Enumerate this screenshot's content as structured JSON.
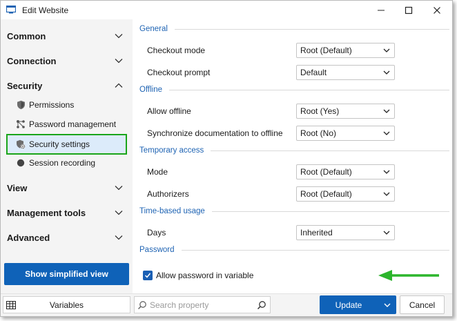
{
  "window": {
    "title": "Edit Website"
  },
  "sidebar": {
    "categories": [
      {
        "label": "Common"
      },
      {
        "label": "Connection"
      },
      {
        "label": "Security"
      },
      {
        "label": "View"
      },
      {
        "label": "Management tools"
      },
      {
        "label": "Advanced"
      }
    ],
    "security_items": [
      {
        "label": "Permissions",
        "icon": "shield-icon"
      },
      {
        "label": "Password management",
        "icon": "share-nodes-icon"
      },
      {
        "label": "Security settings",
        "icon": "shield-gear-icon",
        "selected": true
      },
      {
        "label": "Session recording",
        "icon": "record-dot-icon"
      }
    ],
    "simplified_view_label": "Show simplified view"
  },
  "content": {
    "sections": {
      "general": "General",
      "offline": "Offline",
      "temporary_access": "Temporary access",
      "time_based_usage": "Time-based usage",
      "password": "Password"
    },
    "fields": {
      "checkout_mode": {
        "label": "Checkout mode",
        "value": "Root (Default)"
      },
      "checkout_prompt": {
        "label": "Checkout prompt",
        "value": "Default"
      },
      "allow_offline": {
        "label": "Allow offline",
        "value": "Root (Yes)"
      },
      "sync_docs": {
        "label": "Synchronize documentation to offline",
        "value": "Root (No)"
      },
      "mode": {
        "label": "Mode",
        "value": "Root (Default)"
      },
      "authorizers": {
        "label": "Authorizers",
        "value": "Root (Default)"
      },
      "days": {
        "label": "Days",
        "value": "Inherited"
      }
    },
    "allow_password_in_variable": {
      "label": "Allow password in variable",
      "checked": true
    }
  },
  "bottombar": {
    "variables_label": "Variables",
    "search_placeholder": "Search property",
    "update_label": "Update",
    "cancel_label": "Cancel"
  },
  "colors": {
    "accent": "#0f62b8",
    "section_heading": "#1e63b3",
    "highlight_border": "#1aa51a",
    "annotation_arrow": "#2cb52c"
  }
}
